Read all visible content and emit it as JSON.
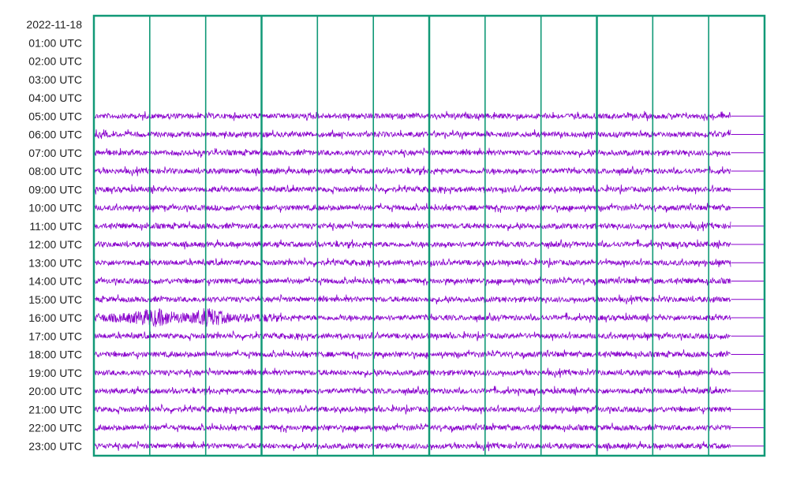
{
  "chart_data": {
    "type": "line",
    "date_label": "2022-11-18",
    "row_labels": [
      "01:00 UTC",
      "02:00 UTC",
      "03:00 UTC",
      "04:00 UTC",
      "05:00 UTC",
      "06:00 UTC",
      "07:00 UTC",
      "08:00 UTC",
      "09:00 UTC",
      "10:00 UTC",
      "11:00 UTC",
      "12:00 UTC",
      "13:00 UTC",
      "14:00 UTC",
      "15:00 UTC",
      "16:00 UTC",
      "17:00 UTC",
      "18:00 UTC",
      "19:00 UTC",
      "20:00 UTC",
      "21:00 UTC",
      "22:00 UTC",
      "23:00 UTC"
    ],
    "traced_rows": [
      "05:00 UTC",
      "06:00 UTC",
      "07:00 UTC",
      "08:00 UTC",
      "09:00 UTC",
      "10:00 UTC",
      "11:00 UTC",
      "12:00 UTC",
      "13:00 UTC",
      "14:00 UTC",
      "15:00 UTC",
      "16:00 UTC",
      "17:00 UTC",
      "18:00 UTC",
      "19:00 UTC",
      "20:00 UTC",
      "21:00 UTC",
      "22:00 UTC",
      "23:00 UTC"
    ],
    "event": {
      "row": "16:00 UTC",
      "start_fraction": 0.0,
      "end_fraction": 0.27
    },
    "trace_end_fraction": 0.95,
    "vertical_divisions": 12,
    "grid": true,
    "colors": {
      "trace": "#8800cc",
      "grid": "#119977",
      "baseline": "#8800cc",
      "text": "#222222",
      "background": "#ffffff"
    }
  }
}
